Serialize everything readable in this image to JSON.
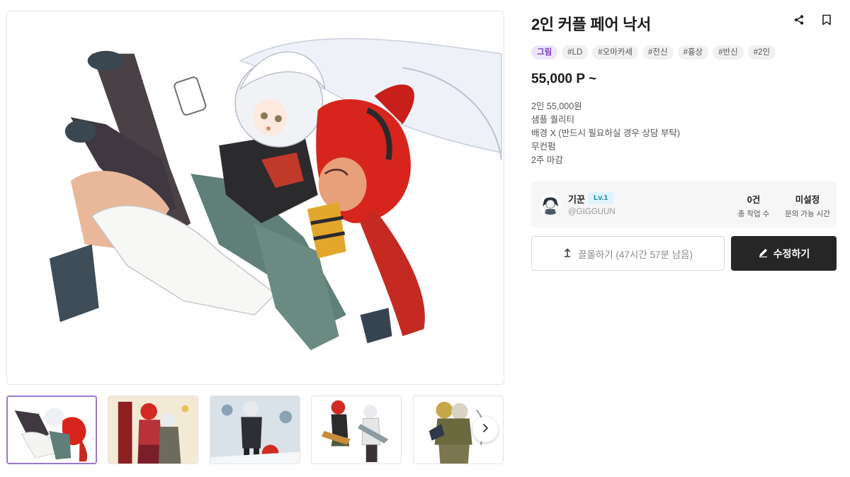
{
  "product": {
    "title": "2인 커플 페어 낙서",
    "price": "55,000 P ~",
    "category_tag": "그림",
    "tags": [
      "#LD",
      "#오마카세",
      "#전신",
      "#흉상",
      "#반신",
      "#2인"
    ],
    "description_lines": [
      "2인 55,000원",
      "샘플 퀄리티",
      "배경 X (반드시 필요하실 경우 상담 부탁)",
      "무컨펌",
      "2주 마감"
    ]
  },
  "artist": {
    "name": "기꾼",
    "level": "Lv.1",
    "handle": "@GIGGUUN",
    "stats": [
      {
        "value": "0건",
        "label": "총 작업 수"
      },
      {
        "value": "미설정",
        "label": "문의 가능 시간"
      }
    ]
  },
  "actions": {
    "pull_up_label": "끌올하기 (47시간 57분 남음)",
    "edit_label": "수정하기"
  },
  "icons": {
    "share": "share-icon",
    "bookmark": "bookmark-icon",
    "pull_up": "pull-up-icon",
    "edit": "pencil-icon",
    "next": "chevron-right-icon"
  },
  "colors": {
    "category_tag_text": "#7a3fc1",
    "category_tag_bg": "#efe6fa",
    "level_badge": "#1b88b3",
    "primary_button": "#262626",
    "active_thumb_border": "#9a78c9"
  },
  "gallery": {
    "thumbnail_count": 5,
    "active_index": 0
  }
}
